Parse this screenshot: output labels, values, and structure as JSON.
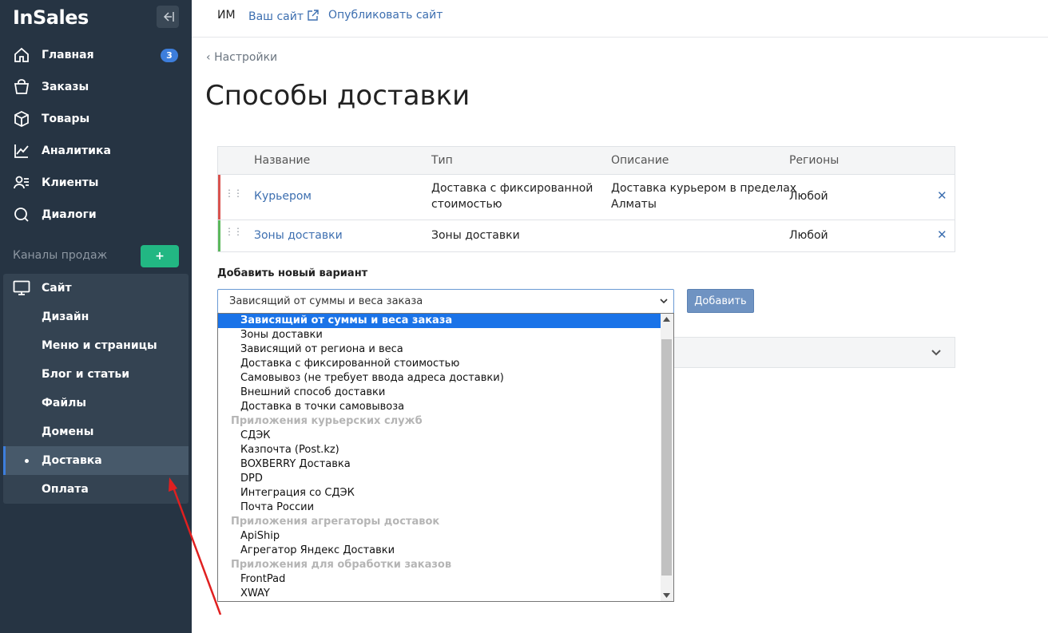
{
  "sidebar": {
    "logo": "InSales",
    "nav": [
      {
        "label": "Главная",
        "icon": "home-icon",
        "badge": "3"
      },
      {
        "label": "Заказы",
        "icon": "bag-icon"
      },
      {
        "label": "Товары",
        "icon": "box-icon"
      },
      {
        "label": "Аналитика",
        "icon": "chart-icon"
      },
      {
        "label": "Клиенты",
        "icon": "users-icon"
      },
      {
        "label": "Диалоги",
        "icon": "chat-icon"
      }
    ],
    "channels_label": "Каналы продаж",
    "add_channel": "+",
    "site": {
      "label": "Сайт",
      "icon": "monitor-icon",
      "items": [
        "Дизайн",
        "Меню и страницы",
        "Блог и статьи",
        "Файлы",
        "Домены",
        "Доставка",
        "Оплата"
      ],
      "active": "Доставка"
    }
  },
  "topbar": {
    "shop_name": "ИМ",
    "site_link": "Ваш сайт",
    "publish_link": "Опубликовать сайт"
  },
  "breadcrumb": "Настройки",
  "page_title": "Способы доставки",
  "table": {
    "headers": [
      "Название",
      "Тип",
      "Описание",
      "Регионы"
    ],
    "rows": [
      {
        "name": "Курьером",
        "type_line1": "Доставка с фиксированной",
        "type_line2": "стоимостью",
        "desc_line1": "Доставка курьером в пределах",
        "desc_line2": "Алматы",
        "regions": "Любой",
        "status_color": "#d9534f"
      },
      {
        "name": "Зоны доставки",
        "type": "Зоны доставки",
        "description": "",
        "regions": "Любой",
        "status_color": "#5cb85c"
      }
    ]
  },
  "add_form": {
    "label": "Добавить новый вариант",
    "selected": "Зависящий от суммы и веса заказа",
    "button": "Добавить"
  },
  "dropdown_options": [
    {
      "text": "Зависящий от суммы и веса заказа",
      "kind": "selected"
    },
    {
      "text": "Зоны доставки",
      "kind": "option"
    },
    {
      "text": "Зависящий от региона и веса",
      "kind": "option"
    },
    {
      "text": "Доставка с фиксированной стоимостью",
      "kind": "option"
    },
    {
      "text": "Самовывоз (не требует ввода адреса доставки)",
      "kind": "option"
    },
    {
      "text": "Внешний способ доставки",
      "kind": "option"
    },
    {
      "text": "Доставка в точки самовывоза",
      "kind": "option"
    },
    {
      "text": "Приложения курьерских служб",
      "kind": "group"
    },
    {
      "text": "СДЭК",
      "kind": "option"
    },
    {
      "text": "Казпочта (Post.kz)",
      "kind": "option"
    },
    {
      "text": "BOXBERRY Доставка",
      "kind": "option"
    },
    {
      "text": "DPD",
      "kind": "option"
    },
    {
      "text": "Интеграция со СДЭК",
      "kind": "option"
    },
    {
      "text": "Почта России",
      "kind": "option"
    },
    {
      "text": "Приложения агрегаторы доставок",
      "kind": "group"
    },
    {
      "text": "ApiShip",
      "kind": "option"
    },
    {
      "text": "Агрегатор Яндекс Доставки",
      "kind": "option"
    },
    {
      "text": "Приложения для обработки заказов",
      "kind": "group"
    },
    {
      "text": "FrontPad",
      "kind": "option"
    },
    {
      "text": "XWAY",
      "kind": "option"
    }
  ],
  "colors": {
    "sidebar_bg": "#263443",
    "accent": "#3d6fb0",
    "annotation_arrow": "#e02020"
  }
}
